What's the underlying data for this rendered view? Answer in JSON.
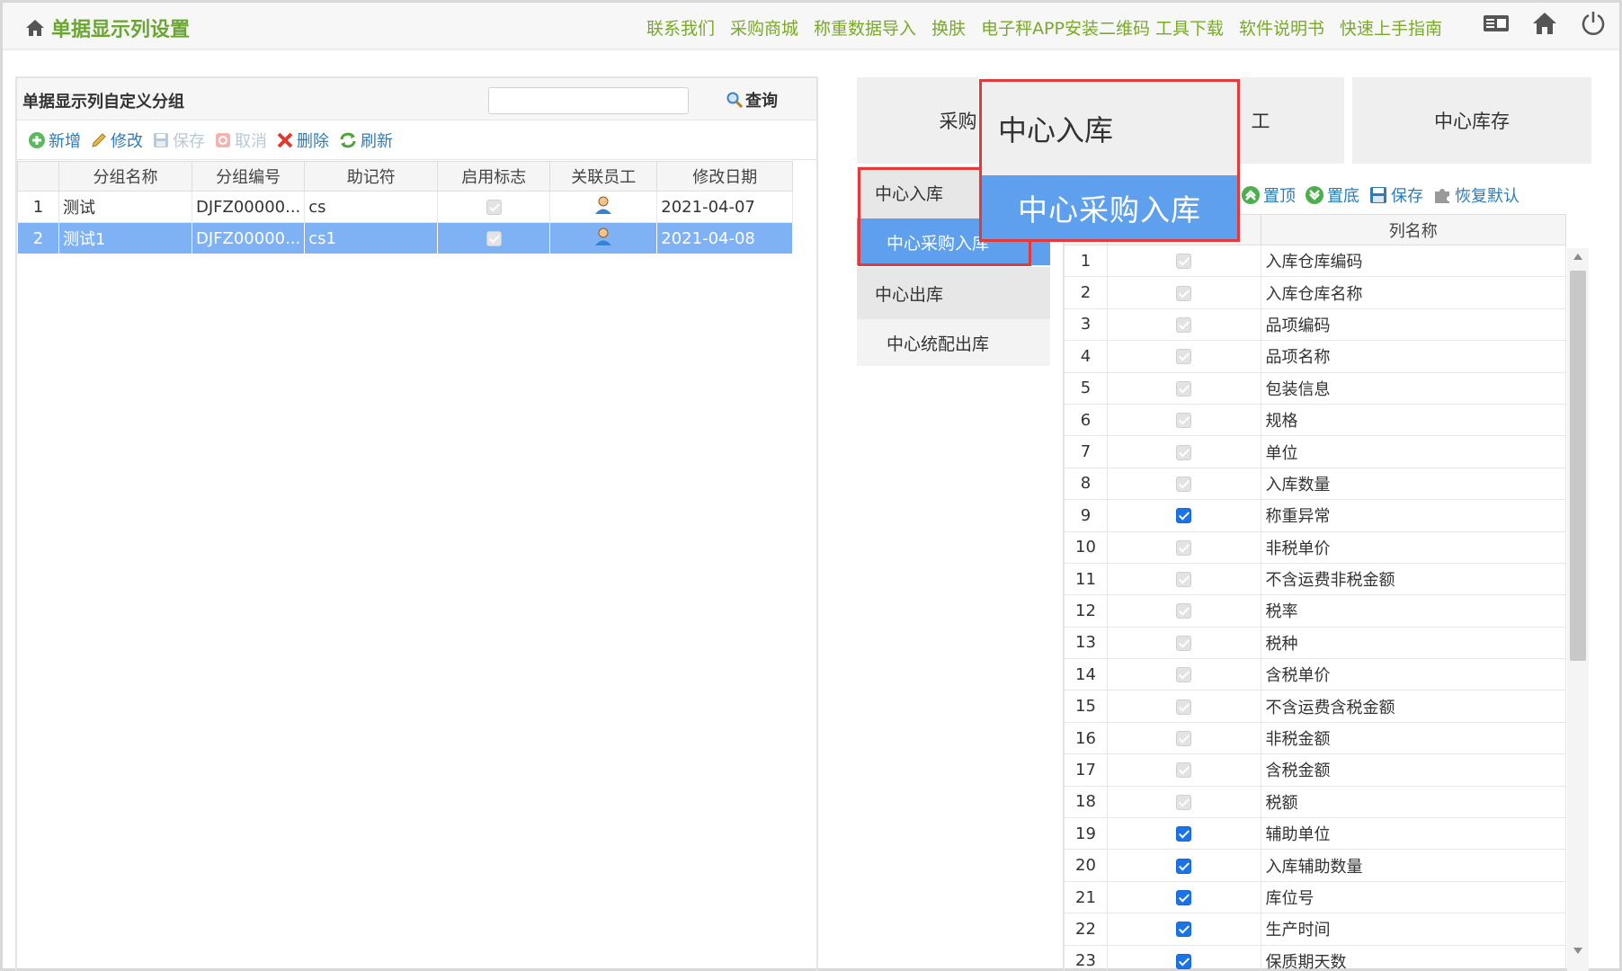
{
  "header": {
    "title": "单据显示列设置",
    "links": [
      "联系我们",
      "采购商城",
      "称重数据导入",
      "换肤",
      "电子秤APP安装二维码 工具下载",
      "软件说明书",
      "快速上手指南"
    ]
  },
  "left_panel": {
    "title": "单据显示列自定义分组",
    "search_placeholder": "",
    "query_label": "查询",
    "toolbar": {
      "add": "新增",
      "edit": "修改",
      "save": "保存",
      "cancel": "取消",
      "delete": "删除",
      "refresh": "刷新"
    },
    "columns": [
      "分组名称",
      "分组编号",
      "助记符",
      "启用标志",
      "关联员工",
      "修改日期"
    ],
    "rows": [
      {
        "n": "1",
        "name": "测试",
        "code": "DJFZ00000...",
        "mnemonic": "cs",
        "date": "2021-04-07"
      },
      {
        "n": "2",
        "name": "测试1",
        "code": "DJFZ00000...",
        "mnemonic": "cs1",
        "date": "2021-04-08"
      }
    ]
  },
  "tabs": {
    "t1": "采购",
    "t2": "工",
    "t3": "中心库存"
  },
  "subnav": {
    "group1": "中心入库",
    "item1": "中心采购入库",
    "group2": "中心出库",
    "item2": "中心统配出库"
  },
  "zoom": {
    "line1": "中心入库",
    "line2": "中心采购入库"
  },
  "right_toolbar": {
    "top": "置顶",
    "bottom": "置底",
    "save": "保存",
    "restore": "恢复默认"
  },
  "column_grid": {
    "header": "列名称",
    "rows": [
      {
        "n": "1",
        "name": "入库仓库编码",
        "checked": false
      },
      {
        "n": "2",
        "name": "入库仓库名称",
        "checked": false
      },
      {
        "n": "3",
        "name": "品项编码",
        "checked": false
      },
      {
        "n": "4",
        "name": "品项名称",
        "checked": false
      },
      {
        "n": "5",
        "name": "包装信息",
        "checked": false
      },
      {
        "n": "6",
        "name": "规格",
        "checked": false
      },
      {
        "n": "7",
        "name": "单位",
        "checked": false
      },
      {
        "n": "8",
        "name": "入库数量",
        "checked": false
      },
      {
        "n": "9",
        "name": "称重异常",
        "checked": true
      },
      {
        "n": "10",
        "name": "非税单价",
        "checked": false
      },
      {
        "n": "11",
        "name": "不含运费非税金额",
        "checked": false
      },
      {
        "n": "12",
        "name": "税率",
        "checked": false
      },
      {
        "n": "13",
        "name": "税种",
        "checked": false
      },
      {
        "n": "14",
        "name": "含税单价",
        "checked": false
      },
      {
        "n": "15",
        "name": "不含运费含税金额",
        "checked": false
      },
      {
        "n": "16",
        "name": "非税金额",
        "checked": false
      },
      {
        "n": "17",
        "name": "含税金额",
        "checked": false
      },
      {
        "n": "18",
        "name": "税额",
        "checked": false
      },
      {
        "n": "19",
        "name": "辅助单位",
        "checked": true
      },
      {
        "n": "20",
        "name": "入库辅助数量",
        "checked": true
      },
      {
        "n": "21",
        "name": "库位号",
        "checked": true
      },
      {
        "n": "22",
        "name": "生产时间",
        "checked": true
      },
      {
        "n": "23",
        "name": "保质期天数",
        "checked": true
      }
    ]
  }
}
